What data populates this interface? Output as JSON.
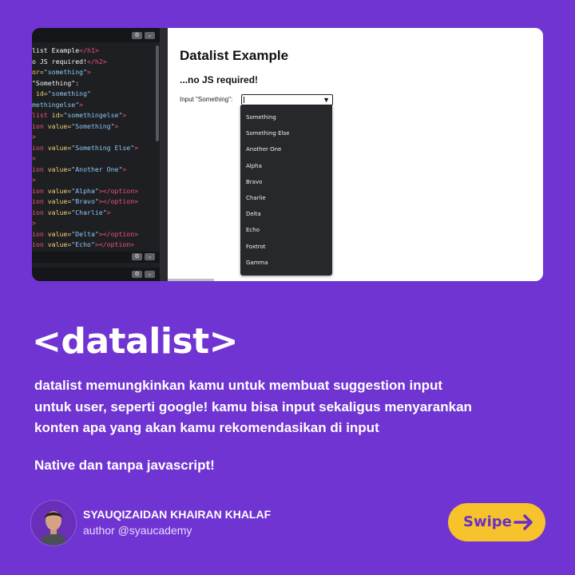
{
  "screenshot": {
    "editor": {
      "code_lines": [
        [
          {
            "t": "list Example",
            "c": "txt"
          },
          {
            "t": "</h1>",
            "c": "tag"
          }
        ],
        [
          {
            "t": "o JS required!",
            "c": "txt"
          },
          {
            "t": "</h2>",
            "c": "tag"
          }
        ],
        [
          {
            "t": "or=",
            "c": "attr"
          },
          {
            "t": "\"something\"",
            "c": "val"
          },
          {
            "t": ">",
            "c": "tag"
          }
        ],
        [
          {
            "t": "\"Something\":",
            "c": "txt"
          }
        ],
        [
          {
            "t": " id=",
            "c": "attr"
          },
          {
            "t": "\"something\"",
            "c": "val"
          }
        ],
        [
          {
            "t": "methingelse\"",
            "c": "val"
          },
          {
            "t": ">",
            "c": "tag"
          }
        ],
        [
          {
            "t": "list ",
            "c": "tag"
          },
          {
            "t": "id=",
            "c": "attr"
          },
          {
            "t": "\"somethingelse\"",
            "c": "val"
          },
          {
            "t": ">",
            "c": "tag"
          }
        ],
        [
          {
            "t": "ion ",
            "c": "tag"
          },
          {
            "t": "value=",
            "c": "attr"
          },
          {
            "t": "\"Something\"",
            "c": "val"
          },
          {
            "t": ">",
            "c": "tag"
          }
        ],
        [
          {
            "t": ">",
            "c": "tag"
          }
        ],
        [
          {
            "t": "ion ",
            "c": "tag"
          },
          {
            "t": "value=",
            "c": "attr"
          },
          {
            "t": "\"Something Else\"",
            "c": "val"
          },
          {
            "t": ">",
            "c": "tag"
          }
        ],
        [
          {
            "t": ">",
            "c": "tag"
          }
        ],
        [
          {
            "t": "ion ",
            "c": "tag"
          },
          {
            "t": "value=",
            "c": "attr"
          },
          {
            "t": "\"Another One\"",
            "c": "val"
          },
          {
            "t": ">",
            "c": "tag"
          }
        ],
        [
          {
            "t": ">",
            "c": "tag"
          }
        ],
        [
          {
            "t": "ion ",
            "c": "tag"
          },
          {
            "t": "value=",
            "c": "attr"
          },
          {
            "t": "\"Alpha\"",
            "c": "val"
          },
          {
            "t": "></option>",
            "c": "tag"
          }
        ],
        [
          {
            "t": "ion ",
            "c": "tag"
          },
          {
            "t": "value=",
            "c": "attr"
          },
          {
            "t": "\"Bravo\"",
            "c": "val"
          },
          {
            "t": "></option>",
            "c": "tag"
          }
        ],
        [
          {
            "t": "ion ",
            "c": "tag"
          },
          {
            "t": "value=",
            "c": "attr"
          },
          {
            "t": "\"Charlie\"",
            "c": "val"
          },
          {
            "t": ">",
            "c": "tag"
          }
        ],
        [
          {
            "t": ">",
            "c": "tag"
          }
        ],
        [
          {
            "t": "ion ",
            "c": "tag"
          },
          {
            "t": "value=",
            "c": "attr"
          },
          {
            "t": "\"Delta\"",
            "c": "val"
          },
          {
            "t": "></option>",
            "c": "tag"
          }
        ],
        [
          {
            "t": "ion ",
            "c": "tag"
          },
          {
            "t": "value=",
            "c": "attr"
          },
          {
            "t": "\"Echo\"",
            "c": "val"
          },
          {
            "t": "></option>",
            "c": "tag"
          }
        ]
      ]
    },
    "preview": {
      "heading": "Datalist Example",
      "subheading": "...no JS required!",
      "input_label": "Input \"Something\":",
      "options": [
        "Something",
        "Something Else",
        "Another One",
        "Alpha",
        "Bravo",
        "Charlie",
        "Delta",
        "Echo",
        "Foxtrot",
        "Gamma"
      ]
    }
  },
  "title": "<datalist>",
  "description_lines": [
    "datalist memungkinkan kamu untuk membuat suggestion input",
    "untuk user, seperti google! kamu bisa input sekaligus menyarankan",
    "konten apa yang akan kamu rekomendasikan di input"
  ],
  "note": "Native dan tanpa javascript!",
  "author": {
    "name": "SYAUQIZAIDAN KHAIRAN KHALAF",
    "handle": "author @syaucademy"
  },
  "swipe_label": "Swipe",
  "colors": {
    "background": "#7034d2",
    "swipe_button": "#f6c32c",
    "swipe_text": "#6a2fc4"
  }
}
